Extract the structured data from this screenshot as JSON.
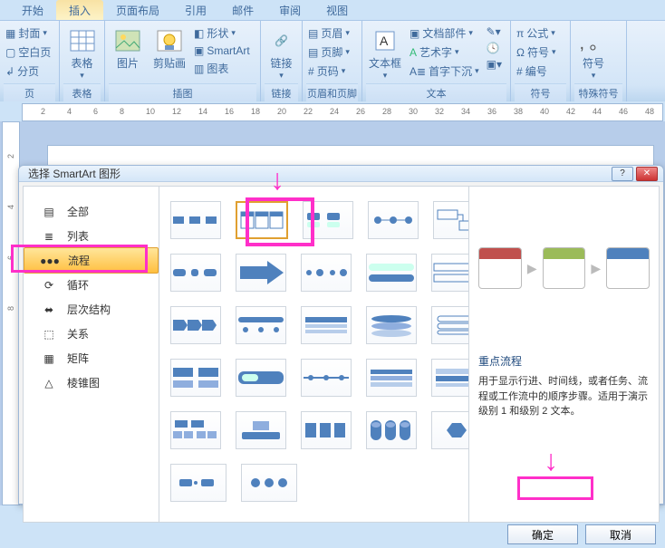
{
  "tabs": [
    "开始",
    "插入",
    "页面布局",
    "引用",
    "邮件",
    "审阅",
    "视图"
  ],
  "active_tab": 1,
  "ribbon": {
    "groups": [
      {
        "label": "页",
        "items": [
          "封面",
          "空白页",
          "分页"
        ]
      },
      {
        "label": "表格",
        "items": [
          "表格"
        ]
      },
      {
        "label": "插图",
        "items": [
          "图片",
          "剪贴画",
          "形状",
          "SmartArt",
          "图表"
        ]
      },
      {
        "label": "链接",
        "items": [
          "链接"
        ]
      },
      {
        "label": "页眉和页脚",
        "items": [
          "页眉",
          "页脚",
          "页码"
        ]
      },
      {
        "label": "文本",
        "items": [
          "文本框",
          "文档部件",
          "艺术字",
          "首字下沉"
        ]
      },
      {
        "label": "符号",
        "items": [
          "公式",
          "符号",
          "编号"
        ]
      },
      {
        "label": "特殊符号",
        "items": [
          "符号"
        ]
      }
    ]
  },
  "ruler_marks": [
    "2",
    "4",
    "6",
    "8",
    "10",
    "12",
    "14",
    "16",
    "18",
    "20",
    "22",
    "24",
    "26",
    "28",
    "30",
    "32",
    "34",
    "36",
    "38",
    "40",
    "42",
    "44",
    "46",
    "48"
  ],
  "vruler_marks": [
    "2",
    "4",
    "6",
    "8"
  ],
  "dialog": {
    "title": "选择 SmartArt 图形",
    "categories": [
      {
        "label": "全部",
        "key": "all"
      },
      {
        "label": "列表",
        "key": "list"
      },
      {
        "label": "流程",
        "key": "process"
      },
      {
        "label": "循环",
        "key": "cycle"
      },
      {
        "label": "层次结构",
        "key": "hierarchy"
      },
      {
        "label": "关系",
        "key": "relationship"
      },
      {
        "label": "矩阵",
        "key": "matrix"
      },
      {
        "label": "棱锥图",
        "key": "pyramid"
      }
    ],
    "active_category": 2,
    "preview": {
      "title": "重点流程",
      "desc": "用于显示行进、时间线，或者任务、流程或工作流中的顺序步骤。适用于演示级别 1 和级别 2 文本。"
    },
    "buttons": {
      "ok": "确定",
      "cancel": "取消"
    }
  }
}
